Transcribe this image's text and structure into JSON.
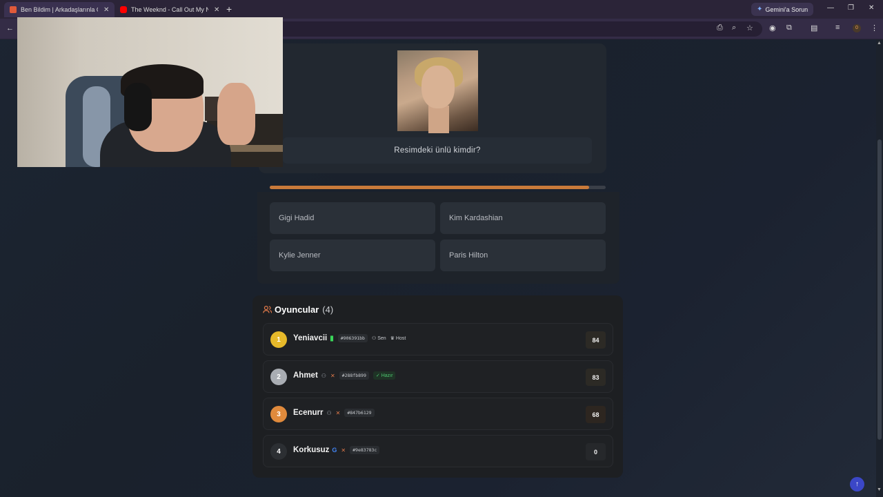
{
  "browser": {
    "tabs": [
      {
        "title": "Ben Bildim | Arkadaşlarınla Onli",
        "active": true
      },
      {
        "title": "The Weeknd - Call Out My Nam",
        "active": false
      }
    ],
    "new_tab": "+",
    "gemini_label": "Gemini'a Sorun",
    "badge": "0",
    "window_controls": {
      "minimize": "—",
      "restore": "❐",
      "close": "✕"
    }
  },
  "quiz": {
    "question": "Resimdeki ünlü kimdir?",
    "timer_progress": 0.95,
    "answers": [
      "Gigi Hadid",
      "Kim Kardashian",
      "Kylie Jenner",
      "Paris Hilton"
    ]
  },
  "players": {
    "title": "Oyuncular",
    "count": "(4)",
    "list": [
      {
        "rank": "1",
        "name": "Yeniavcii",
        "id": "#906391bb",
        "you": "Sen",
        "host": "Host",
        "score": "84",
        "rank_color": "#e6b92a"
      },
      {
        "rank": "2",
        "name": "Ahmet",
        "id": "#288fb899",
        "ready": "Hazır",
        "score": "83",
        "rank_color": "#a9adb3"
      },
      {
        "rank": "3",
        "name": "Ecenurr",
        "id": "#847b6129",
        "score": "68",
        "rank_color": "#e08a3c"
      },
      {
        "rank": "4",
        "name": "Korkusuz",
        "id": "#9e83783c",
        "score": "0",
        "rank_color": "#2c2f33"
      }
    ]
  },
  "colors": {
    "accent": "#c97a3a",
    "fab": "#3b47c7"
  }
}
